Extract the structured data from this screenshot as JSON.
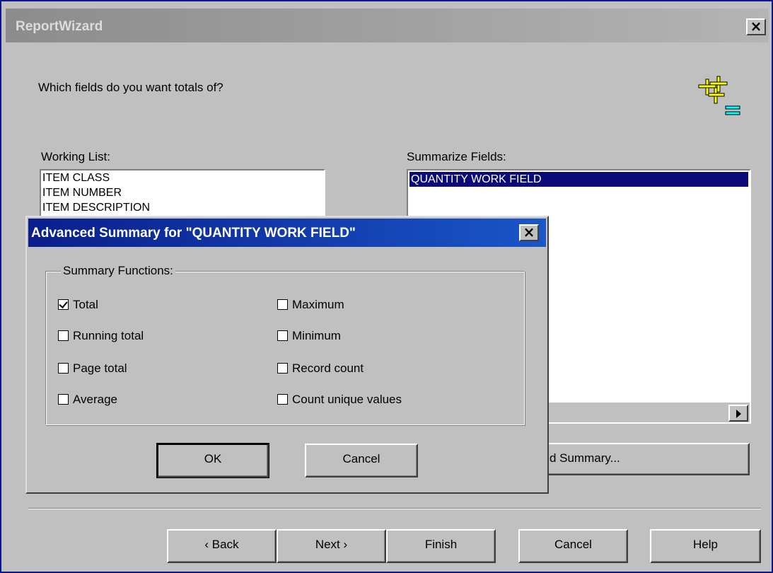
{
  "wizard": {
    "title": "ReportWizard",
    "question": "Which fields do you want totals of?",
    "working_list_label": "Working List:",
    "working_list_items": [
      "ITEM CLASS",
      "ITEM NUMBER",
      "ITEM DESCRIPTION"
    ],
    "summarize_label": "Summarize Fields:",
    "summarize_items": [
      "QUANTITY WORK FIELD"
    ],
    "advanced_summary_label": "ced Summary...",
    "buttons": {
      "back": "‹ Back",
      "next": "Next ›",
      "finish": "Finish",
      "cancel": "Cancel",
      "help": "Help"
    },
    "close_glyph": "×"
  },
  "dialog": {
    "title": "Advanced Summary for \"QUANTITY WORK FIELD\"",
    "close_glyph": "×",
    "group_label": "Summary Functions:",
    "left_options": [
      {
        "label": "Total",
        "checked": true
      },
      {
        "label": "Running total",
        "checked": false
      },
      {
        "label": "Page total",
        "checked": false
      },
      {
        "label": "Average",
        "checked": false
      }
    ],
    "right_options": [
      {
        "label": "Maximum",
        "checked": false
      },
      {
        "label": "Minimum",
        "checked": false
      },
      {
        "label": "Record count",
        "checked": false
      },
      {
        "label": "Count unique values",
        "checked": false
      }
    ],
    "ok": "OK",
    "cancel": "Cancel"
  },
  "colors": {
    "dialog_title_bg": "#0a1e8c",
    "selection_bg": "#0a0a78",
    "window_border": "#0a1a8a",
    "logo_yellow": "#ffff00",
    "logo_cyan": "#00ffff"
  },
  "icons": {
    "logo": "summary-sigma-icon"
  }
}
